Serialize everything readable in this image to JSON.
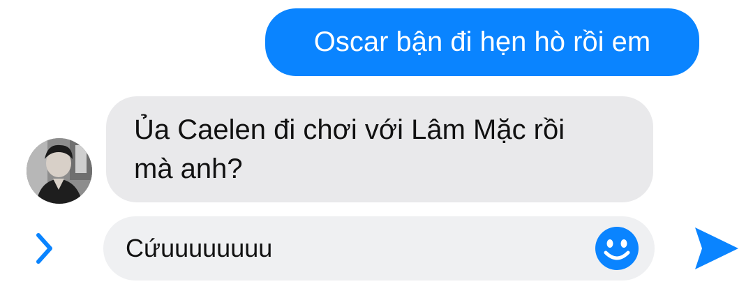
{
  "conversation": {
    "messages": [
      {
        "direction": "outgoing",
        "text": "Oscar bận đi hẹn hò rồi em"
      },
      {
        "direction": "incoming",
        "lines": [
          "Ủa Caelen đi chơi với Lâm Mặc rồi",
          "mà anh?"
        ]
      }
    ]
  },
  "composer": {
    "input_value": "Cứuuuuuuuu",
    "expand_icon": "chevron-right-icon",
    "emoji_icon": "smiley-icon",
    "send_icon": "send-arrow-icon"
  },
  "colors": {
    "accent": "#0a84ff",
    "outgoing_bubble": "#0a84ff",
    "incoming_bubble": "#e9e9eb",
    "input_background": "#eff0f2"
  }
}
